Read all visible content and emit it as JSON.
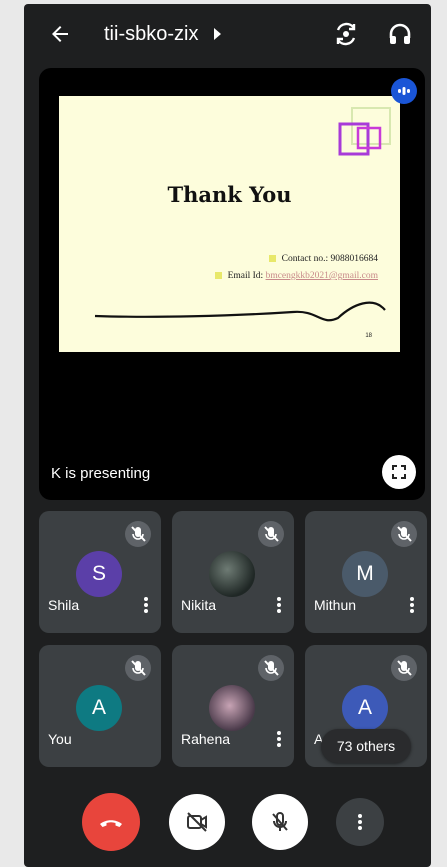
{
  "header": {
    "meeting_code": "tii-sbko-zix",
    "back_icon": "arrow-back-icon",
    "switch_camera_icon": "camera-flip-icon",
    "audio_output_icon": "headset-icon"
  },
  "presentation": {
    "slide_title": "Thank You",
    "contact_text": "Contact no.: 9088016684",
    "email_label": "Email Id:",
    "email_value": "bmcengkkb2021@gmail.com",
    "slide_number": "18",
    "presenter_text": "K is presenting"
  },
  "participants": [
    {
      "name": "Shila",
      "initial": "S",
      "avatar_color": "#5b3fa8",
      "muted": true
    },
    {
      "name": "Nikita",
      "initial": "",
      "avatar_color": "#2e3a3a",
      "muted": true
    },
    {
      "name": "Mithun",
      "initial": "M",
      "avatar_color": "#4a5a6a",
      "muted": true
    },
    {
      "name": "You",
      "initial": "A",
      "avatar_color": "#0e7a82",
      "muted": true
    },
    {
      "name": "Rahena",
      "initial": "",
      "avatar_color": "#6a4c6a",
      "muted": true
    },
    {
      "name": "An",
      "initial": "A",
      "avatar_color": "#3d5ab8",
      "muted": true
    }
  ],
  "others_count_label": "73 others",
  "controls": {
    "end_call_color": "#e8453c",
    "camera_state": "off",
    "mic_state": "muted"
  },
  "colors": {
    "background": "#1e1f20",
    "tile": "#3c4043",
    "accent_blue": "#1a55d6"
  }
}
